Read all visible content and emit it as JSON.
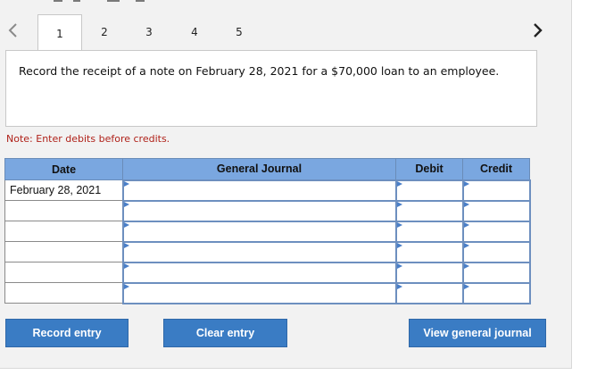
{
  "tabs": [
    {
      "label": "1",
      "active": true
    },
    {
      "label": "2",
      "active": false
    },
    {
      "label": "3",
      "active": false
    },
    {
      "label": "4",
      "active": false
    },
    {
      "label": "5",
      "active": false
    }
  ],
  "nav": {
    "prev_icon": "chevron-left-icon",
    "next_icon": "chevron-right-icon"
  },
  "question": {
    "text": "Record the receipt of a note on February 28, 2021 for a $70,000 loan to an employee."
  },
  "note": "Note: Enter debits before credits.",
  "journal": {
    "headers": {
      "date": "Date",
      "general_journal": "General Journal",
      "debit": "Debit",
      "credit": "Credit"
    },
    "rows": [
      {
        "date": "February 28, 2021",
        "account": "",
        "debit": "",
        "credit": ""
      },
      {
        "date": "",
        "account": "",
        "debit": "",
        "credit": ""
      },
      {
        "date": "",
        "account": "",
        "debit": "",
        "credit": ""
      },
      {
        "date": "",
        "account": "",
        "debit": "",
        "credit": ""
      },
      {
        "date": "",
        "account": "",
        "debit": "",
        "credit": ""
      },
      {
        "date": "",
        "account": "",
        "debit": "",
        "credit": ""
      }
    ]
  },
  "buttons": {
    "record": "Record entry",
    "clear": "Clear entry",
    "view": "View general journal"
  },
  "colors": {
    "header_bg": "#7aa7e0",
    "button_bg": "#3a7cc4",
    "note_text": "#b0221a"
  }
}
